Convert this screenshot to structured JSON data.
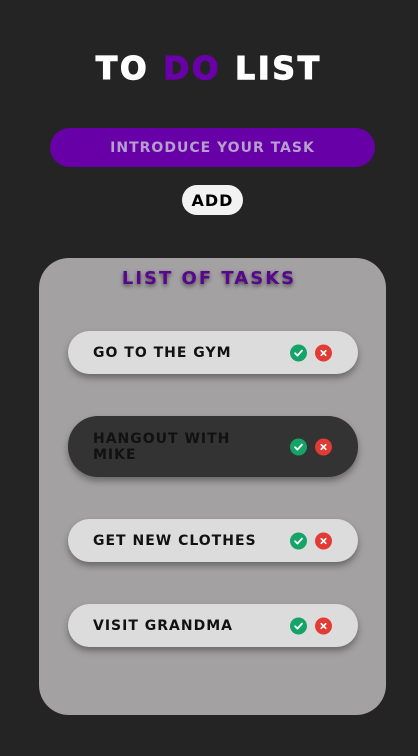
{
  "header": {
    "title_part1": "TO",
    "title_accent": "DO",
    "title_part2": "LIST"
  },
  "form": {
    "input_placeholder": "INTRODUCE YOUR TASK",
    "add_label": "ADD"
  },
  "list": {
    "title": "LIST OF TASKS",
    "tasks": [
      {
        "label": "GO TO THE GYM",
        "complete_icon": "check-circle-icon",
        "delete_icon": "x-circle-icon"
      },
      {
        "label": "HANGOUT WITH MIKE",
        "complete_icon": "check-circle-icon",
        "delete_icon": "x-circle-icon"
      },
      {
        "label": "GET NEW CLOTHES",
        "complete_icon": "check-circle-icon",
        "delete_icon": "x-circle-icon"
      },
      {
        "label": "VISIT GRANDMA",
        "complete_icon": "check-circle-icon",
        "delete_icon": "x-circle-icon"
      }
    ]
  },
  "colors": {
    "background": "#242424",
    "accent_purple": "#6800a8",
    "panel_gray": "#a3a1a2",
    "check_green": "#16a368",
    "cross_red": "#e23b34"
  }
}
